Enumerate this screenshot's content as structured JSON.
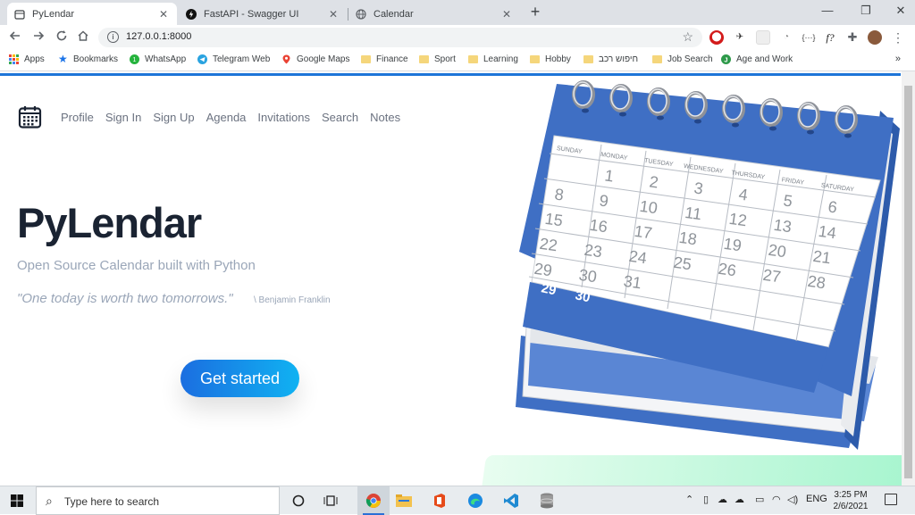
{
  "browser": {
    "tabs": [
      {
        "title": "PyLendar",
        "active": true,
        "icon": "calendar-icon"
      },
      {
        "title": "FastAPI - Swagger UI",
        "active": false,
        "icon": "fastapi-icon"
      },
      {
        "title": "Calendar",
        "active": false,
        "icon": "globe-icon"
      }
    ],
    "new_tab": "+",
    "window_controls": [
      "—",
      "❐",
      "✕"
    ],
    "url": "127.0.0.1:8000",
    "extension_badge": "f?",
    "bookmarks": [
      {
        "label": "Apps",
        "icon": "apps-grid-icon"
      },
      {
        "label": "Bookmarks",
        "icon": "star-icon"
      },
      {
        "label": "WhatsApp",
        "icon": "whatsapp-icon"
      },
      {
        "label": "Telegram Web",
        "icon": "telegram-icon"
      },
      {
        "label": "Google Maps",
        "icon": "maps-pin-icon"
      },
      {
        "label": "Finance",
        "icon": "folder-icon"
      },
      {
        "label": "Sport",
        "icon": "folder-icon"
      },
      {
        "label": "Learning",
        "icon": "folder-icon"
      },
      {
        "label": "Hobby",
        "icon": "folder-icon"
      },
      {
        "label": "חיפוש רכב",
        "icon": "folder-icon"
      },
      {
        "label": "Job Search",
        "icon": "folder-icon"
      },
      {
        "label": "Age and Work",
        "icon": "letter-j-icon"
      }
    ],
    "bookmarks_more": "»"
  },
  "page": {
    "nav": [
      "Profile",
      "Sign In",
      "Sign Up",
      "Agenda",
      "Invitations",
      "Search",
      "Notes"
    ],
    "title": "PyLendar",
    "subtitle": "Open Source Calendar built with Python",
    "quote": "\"One today is worth two tomorrows.\"",
    "quote_author": "\\ Benjamin Franklin",
    "cta": "Get started",
    "calendar_art": {
      "days": [
        "SUNDAY",
        "MONDAY",
        "TUESDAY",
        "WEDNESDAY",
        "THURSDAY",
        "FRIDAY",
        "SATURDAY"
      ],
      "weeks": [
        [
          "",
          "1",
          "2",
          "3",
          "4",
          "5",
          "6"
        ],
        [
          "8",
          "9",
          "10",
          "11",
          "12",
          "13",
          "14"
        ],
        [
          "15",
          "16",
          "17",
          "18",
          "19",
          "20",
          "21"
        ],
        [
          "22",
          "23",
          "24",
          "25",
          "26",
          "27",
          "28"
        ],
        [
          "29",
          "30",
          "31",
          "",
          "",
          "",
          ""
        ]
      ],
      "back_page_dates": [
        "29",
        "30"
      ],
      "colors": {
        "blue": "#3f6fc4",
        "paper": "#ffffff",
        "grid": "#b7bcc4",
        "digits": "#8f949a"
      }
    }
  },
  "taskbar": {
    "search_placeholder": "Type here to search",
    "language": "ENG",
    "time": "3:25 PM",
    "date": "2/6/2021"
  }
}
